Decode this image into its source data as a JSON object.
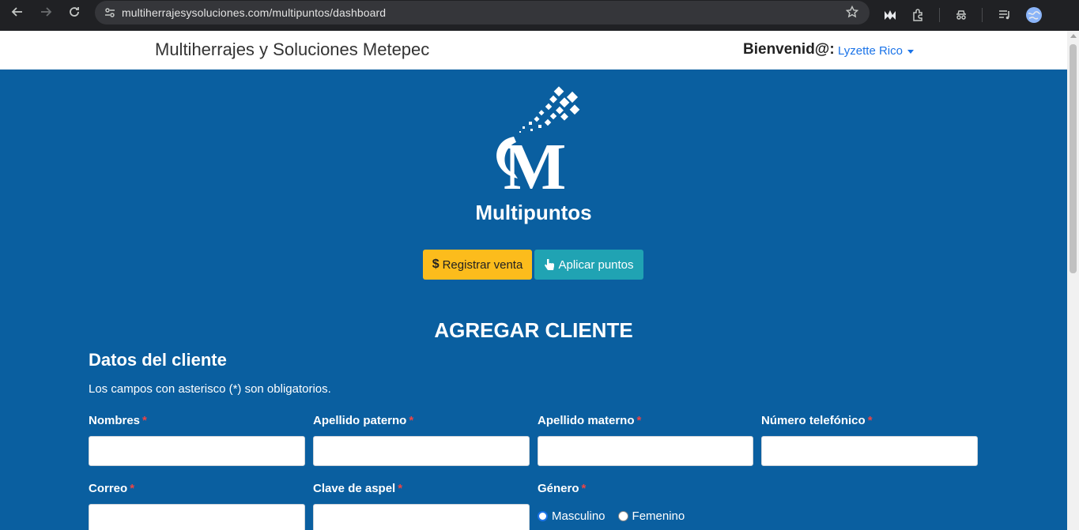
{
  "browser": {
    "url": "multiherrajesysoluciones.com/multipuntos/dashboard"
  },
  "navbar": {
    "brand": "Multiherrajes y Soluciones Metepec",
    "welcome": "Bienvenid@:",
    "user_name": "Lyzette Rico"
  },
  "main": {
    "app_title": "Multipuntos",
    "register_sale_label": "Registrar venta",
    "apply_points_label": "Aplicar puntos",
    "section_title": "AGREGAR CLIENTE",
    "subsection_title": "Datos del cliente",
    "required_note": "Los campos con asterisco (*) son obligatorios."
  },
  "form": {
    "required_mark": "*",
    "fields": [
      {
        "label": "Nombres",
        "value": ""
      },
      {
        "label": "Apellido paterno",
        "value": ""
      },
      {
        "label": "Apellido materno",
        "value": ""
      },
      {
        "label": "Número telefónico",
        "value": ""
      },
      {
        "label": "Correo",
        "value": ""
      },
      {
        "label": "Clave de aspel",
        "value": ""
      }
    ],
    "gender_label": "Género",
    "gender_options": [
      "Masculino",
      "Femenino"
    ],
    "gender_selected": "Masculino"
  },
  "colors": {
    "page_bg": "#0a5fa0",
    "warning": "#fcbc1c",
    "info": "#20a3b3",
    "link": "#1a73e8"
  }
}
